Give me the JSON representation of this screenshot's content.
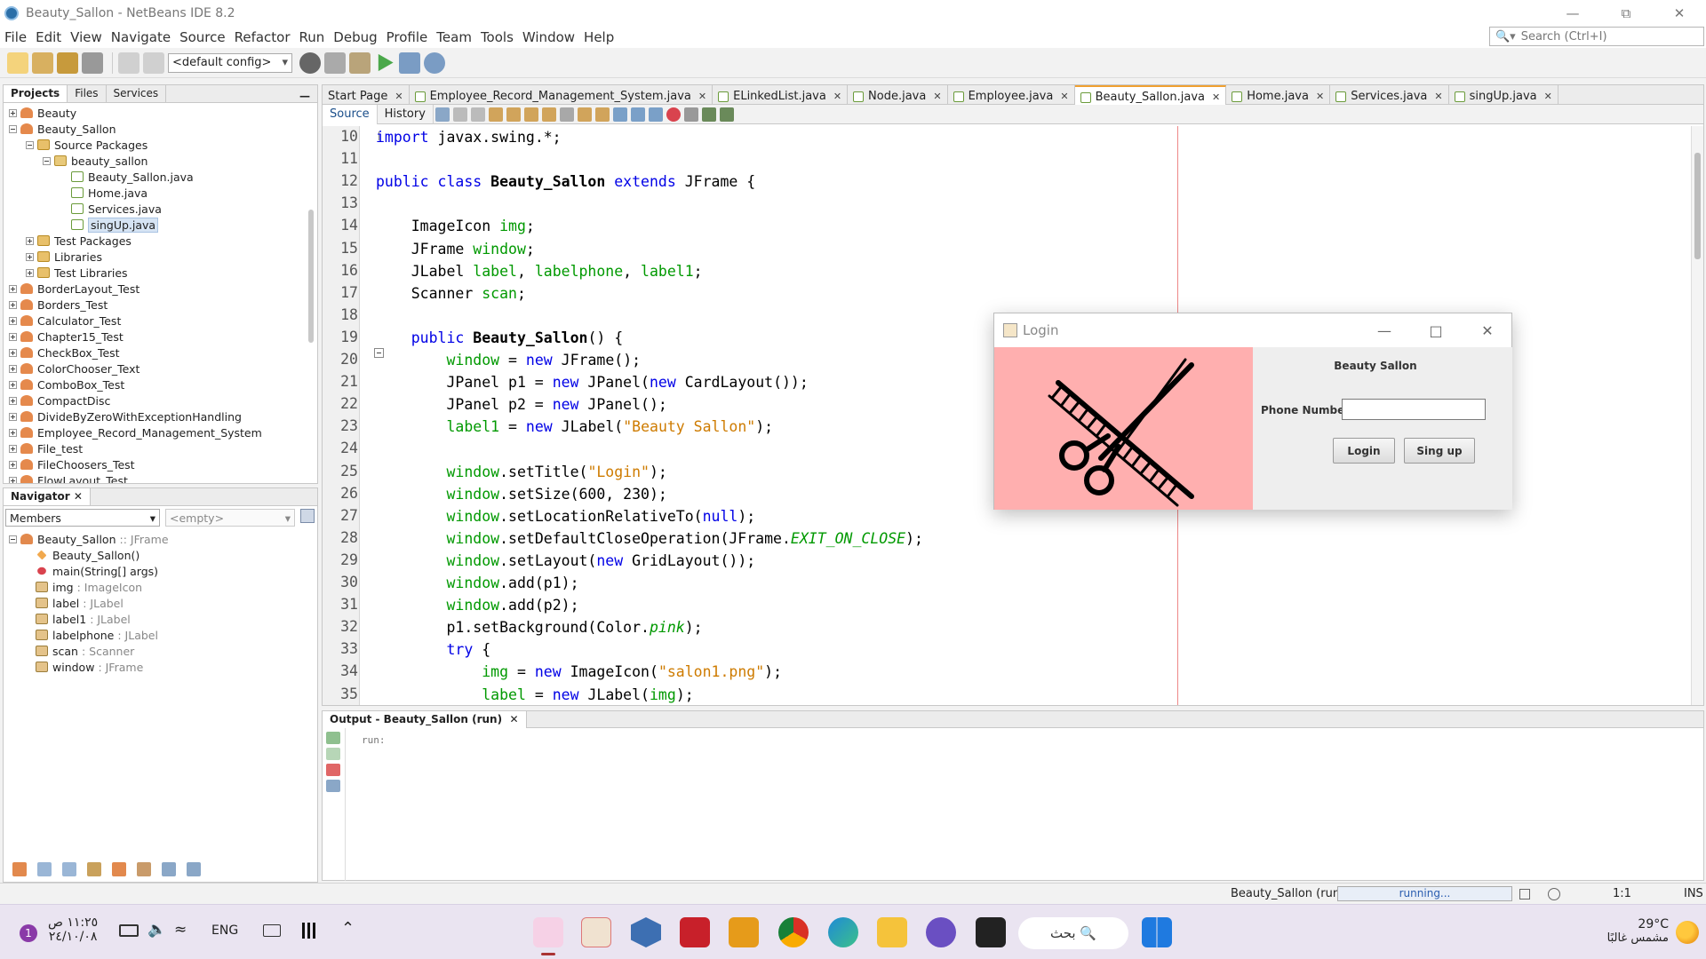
{
  "window": {
    "title": "Beauty_Sallon - NetBeans IDE 8.2"
  },
  "menu": [
    "File",
    "Edit",
    "View",
    "Navigate",
    "Source",
    "Refactor",
    "Run",
    "Debug",
    "Profile",
    "Team",
    "Tools",
    "Window",
    "Help"
  ],
  "search": {
    "placeholder": "Search (Ctrl+I)"
  },
  "toolbar": {
    "config": "<default config>"
  },
  "projects_panel": {
    "tabs": [
      "Projects",
      "Files",
      "Services"
    ],
    "tree": [
      {
        "label": "Beauty",
        "type": "proj",
        "level": 0,
        "toggle": "p"
      },
      {
        "label": "Beauty_Sallon",
        "type": "proj",
        "level": 0,
        "toggle": "m"
      },
      {
        "label": "Source Packages",
        "type": "folder",
        "level": 1,
        "toggle": "m"
      },
      {
        "label": "beauty_sallon",
        "type": "pkg",
        "level": 2,
        "toggle": "m"
      },
      {
        "label": "Beauty_Sallon.java",
        "type": "java",
        "level": 3,
        "toggle": ""
      },
      {
        "label": "Home.java",
        "type": "java",
        "level": 3,
        "toggle": ""
      },
      {
        "label": "Services.java",
        "type": "java",
        "level": 3,
        "toggle": ""
      },
      {
        "label": "singUp.java",
        "type": "java",
        "level": 3,
        "toggle": "",
        "selected": true
      },
      {
        "label": "Test Packages",
        "type": "folder",
        "level": 1,
        "toggle": "p"
      },
      {
        "label": "Libraries",
        "type": "folder",
        "level": 1,
        "toggle": "p"
      },
      {
        "label": "Test Libraries",
        "type": "folder",
        "level": 1,
        "toggle": "p"
      },
      {
        "label": "BorderLayout_Test",
        "type": "proj",
        "level": 0,
        "toggle": "p"
      },
      {
        "label": "Borders_Test",
        "type": "proj",
        "level": 0,
        "toggle": "p"
      },
      {
        "label": "Calculator_Test",
        "type": "proj",
        "level": 0,
        "toggle": "p"
      },
      {
        "label": "Chapter15_Test",
        "type": "proj",
        "level": 0,
        "toggle": "p"
      },
      {
        "label": "CheckBox_Test",
        "type": "proj",
        "level": 0,
        "toggle": "p"
      },
      {
        "label": "ColorChooser_Text",
        "type": "proj",
        "level": 0,
        "toggle": "p"
      },
      {
        "label": "ComboBox_Test",
        "type": "proj",
        "level": 0,
        "toggle": "p"
      },
      {
        "label": "CompactDisc",
        "type": "proj",
        "level": 0,
        "toggle": "p"
      },
      {
        "label": "DivideByZeroWithExceptionHandling",
        "type": "proj",
        "level": 0,
        "toggle": "p"
      },
      {
        "label": "Employee_Record_Management_System",
        "type": "proj",
        "level": 0,
        "toggle": "p"
      },
      {
        "label": "File_test",
        "type": "proj",
        "level": 0,
        "toggle": "p"
      },
      {
        "label": "FileChoosers_Test",
        "type": "proj",
        "level": 0,
        "toggle": "p"
      },
      {
        "label": "FlowLayout_Test",
        "type": "proj",
        "level": 0,
        "toggle": "p"
      }
    ]
  },
  "navigator": {
    "title": "Navigator",
    "filter": "Members",
    "filter2": "<empty>",
    "root": "Beauty_Sallon",
    "root_type": ":: JFrame",
    "members": [
      {
        "name": "Beauty_Sallon()",
        "type": "",
        "kind": "ctor"
      },
      {
        "name": "main(String[] args)",
        "type": "",
        "kind": "meth"
      },
      {
        "name": "img",
        "type": ": ImageIcon",
        "kind": "fld"
      },
      {
        "name": "label",
        "type": ": JLabel",
        "kind": "fld"
      },
      {
        "name": "label1",
        "type": ": JLabel",
        "kind": "fld"
      },
      {
        "name": "labelphone",
        "type": ": JLabel",
        "kind": "fld"
      },
      {
        "name": "scan",
        "type": ": Scanner",
        "kind": "fld"
      },
      {
        "name": "window",
        "type": ": JFrame",
        "kind": "fld"
      }
    ]
  },
  "editor": {
    "tabs": [
      {
        "label": "Start Page",
        "active": false
      },
      {
        "label": "Employee_Record_Management_System.java",
        "active": false
      },
      {
        "label": "ELinkedList.java",
        "active": false
      },
      {
        "label": "Node.java",
        "active": false
      },
      {
        "label": "Employee.java",
        "active": false
      },
      {
        "label": "Beauty_Sallon.java",
        "active": true
      },
      {
        "label": "Home.java",
        "active": false
      },
      {
        "label": "Services.java",
        "active": false
      },
      {
        "label": "singUp.java",
        "active": false
      }
    ],
    "source_tab": "Source",
    "history_tab": "History",
    "lines": [
      {
        "n": "10",
        "html": "<span class='kw'>import</span> javax.swing.*;"
      },
      {
        "n": "11",
        "html": ""
      },
      {
        "n": "12",
        "html": "<span class='kw'>public class</span> <span class='bd'>Beauty_Sallon</span> <span class='kw'>extends</span> JFrame {"
      },
      {
        "n": "13",
        "html": ""
      },
      {
        "n": "14",
        "html": "    ImageIcon <span class='vr'>img</span>;"
      },
      {
        "n": "15",
        "html": "    JFrame <span class='vr'>window</span>;"
      },
      {
        "n": "16",
        "html": "    JLabel <span class='vr'>label</span>, <span class='vr'>labelphone</span>, <span class='vr'>label1</span>;"
      },
      {
        "n": "17",
        "html": "    Scanner <span class='vr'>scan</span>;"
      },
      {
        "n": "18",
        "html": ""
      },
      {
        "n": "19",
        "html": "    <span class='kw'>public</span> <span class='bd'>Beauty_Sallon</span>() {"
      },
      {
        "n": "20",
        "html": "        <span class='vr'>window</span> = <span class='kw'>new</span> JFrame();"
      },
      {
        "n": "21",
        "html": "        JPanel p1 = <span class='kw'>new</span> JPanel(<span class='kw'>new</span> CardLayout());"
      },
      {
        "n": "22",
        "html": "        JPanel p2 = <span class='kw'>new</span> JPanel();"
      },
      {
        "n": "23",
        "html": "        <span class='vr'>label1</span> = <span class='kw'>new</span> JLabel(<span class='st'>\"Beauty Sallon\"</span>);"
      },
      {
        "n": "24",
        "html": ""
      },
      {
        "n": "25",
        "html": "        <span class='vr'>window</span>.setTitle(<span class='st'>\"Login\"</span>);"
      },
      {
        "n": "26",
        "html": "        <span class='vr'>window</span>.setSize(600, 230);"
      },
      {
        "n": "27",
        "html": "        <span class='vr'>window</span>.setLocationRelativeTo(<span class='kw'>null</span>);"
      },
      {
        "n": "28",
        "html": "        <span class='vr'>window</span>.setDefaultCloseOperation(JFrame.<span class='it'>EXIT_ON_CLOSE</span>);"
      },
      {
        "n": "29",
        "html": "        <span class='vr'>window</span>.setLayout(<span class='kw'>new</span> GridLayout());"
      },
      {
        "n": "30",
        "html": "        <span class='vr'>window</span>.add(p1);"
      },
      {
        "n": "31",
        "html": "        <span class='vr'>window</span>.add(p2);"
      },
      {
        "n": "32",
        "html": "        p1.setBackground(Color.<span class='it'>pink</span>);"
      },
      {
        "n": "33",
        "html": "        <span class='kw'>try</span> {"
      },
      {
        "n": "34",
        "html": "            <span class='vr'>img</span> = <span class='kw'>new</span> ImageIcon(<span class='st'>\"salon1.png\"</span>);"
      },
      {
        "n": "35",
        "html": "            <span class='vr'>label</span> = <span class='kw'>new</span> JLabel(<span class='vr'>img</span>);"
      }
    ]
  },
  "output": {
    "tab": "Output - Beauty_Sallon (run)",
    "text": "run:"
  },
  "status": {
    "task": "Beauty_Sallon (run)",
    "progress": "running...",
    "position": "1:1",
    "mode": "INS"
  },
  "dialog": {
    "title": "Login",
    "heading": "Beauty Sallon",
    "phone_label": "Phone Number:",
    "phone_value": "",
    "login_button": "Login",
    "signup_button": "Sing up",
    "pink_color": "#ffafaf"
  },
  "taskbar": {
    "time": "١١:٢٥ ص",
    "date": "٢٤/١٠/٠٨",
    "lang": "ENG",
    "search": "بحث",
    "temp": "29°C",
    "weather": "مشمس غالبًا",
    "notify": "1"
  }
}
